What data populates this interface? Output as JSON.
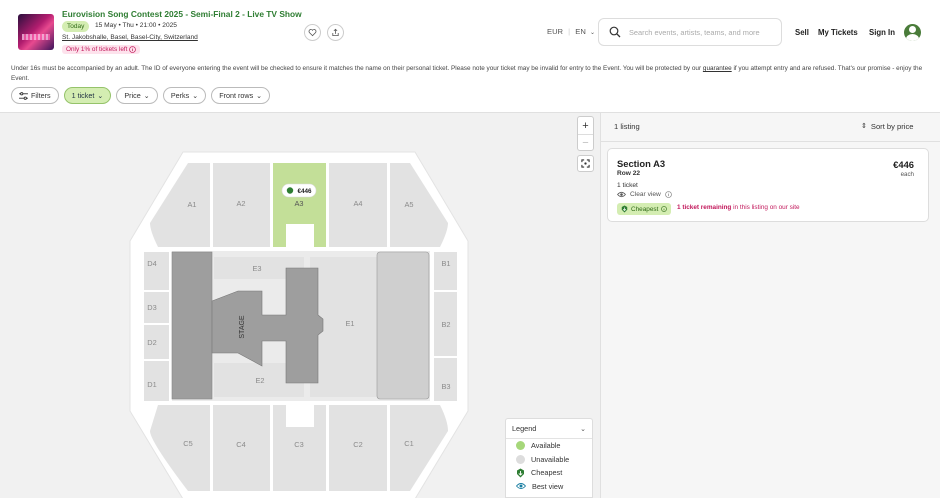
{
  "event": {
    "title": "Eurovision Song Contest 2025 - Semi-Final 2 - Live TV Show",
    "today_badge": "Today",
    "datetime": "15 May • Thu • 21:00 • 2025",
    "venue": "St. Jakobshalle, Basel, Basel-City, Switzerland",
    "scarcity": "Only 1% of tickets left"
  },
  "header": {
    "currency": "EUR",
    "separator": "|",
    "language": "EN",
    "search_placeholder": "Search events, artists, teams, and more",
    "sell": "Sell",
    "my_tickets": "My Tickets",
    "sign_in": "Sign In"
  },
  "notice": {
    "before": "Under 16s must be accompanied by an adult. The ID of everyone entering the event will be checked to ensure it matches the name on their personal ticket. Please note your ticket may be invalid for entry to the Event. You will be protected by our ",
    "link": "guarantee",
    "after": " if you attempt entry and are refused. That's our promise - enjoy the Event."
  },
  "filters": {
    "filters": "Filters",
    "tickets": "1 ticket",
    "price": "Price",
    "perks": "Perks",
    "front_rows": "Front rows"
  },
  "map": {
    "stage": "STAGE",
    "price_tag": "€446",
    "sections": {
      "A1": "A1",
      "A2": "A2",
      "A3": "A3",
      "A4": "A4",
      "A5": "A5",
      "B1": "B1",
      "B2": "B2",
      "B3": "B3",
      "C1": "C1",
      "C2": "C2",
      "C3": "C3",
      "C4": "C4",
      "C5": "C5",
      "D1": "D1",
      "D2": "D2",
      "D3": "D3",
      "D4": "D4",
      "E1": "E1",
      "E2": "E2",
      "E3": "E3"
    },
    "zoom_in": "+",
    "zoom_out": "−"
  },
  "legend": {
    "title": "Legend",
    "items": [
      {
        "label": "Available",
        "color": "#a6d77a"
      },
      {
        "label": "Unavailable",
        "color": "#dddddd"
      },
      {
        "label": "Cheapest",
        "color": "#2e7d32"
      },
      {
        "label": "Best view",
        "color": "#1a7fa3"
      }
    ]
  },
  "listings": {
    "count": "1 listing",
    "sort": "Sort by price",
    "items": [
      {
        "section": "Section A3",
        "row": "Row 22",
        "tickets": "1 ticket",
        "view": "Clear view",
        "badge": "Cheapest",
        "remaining_bold": "1 ticket remaining",
        "remaining_rest": " in this listing on our site",
        "price": "€446",
        "each": "each"
      }
    ]
  },
  "colors": {
    "accent_green": "#2e7d32",
    "available_fill": "#c3df98",
    "pink": "#c2185b"
  }
}
